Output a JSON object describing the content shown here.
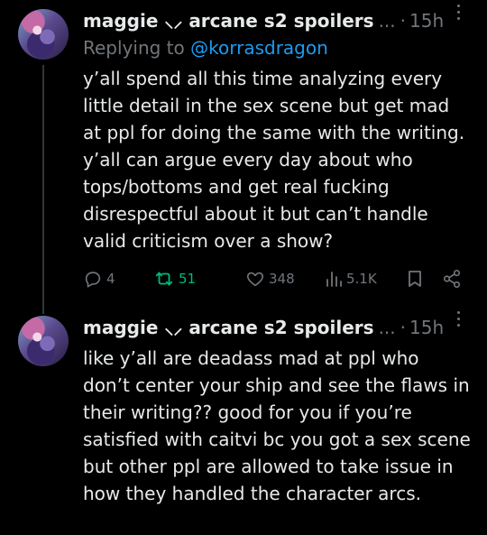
{
  "tweets": [
    {
      "display_name": "maggie ⸜⸝ arcane s2 spoilers",
      "ellipsis": "...",
      "dot": "·",
      "time": "15h",
      "reply_prefix": "Replying to",
      "reply_handle": "@korrasdragon",
      "text": "y’all spend all this time analyzing every little detail in the sex scene but get mad at ppl for doing the same with the writing. y’all can argue every day about who tops/bottoms and get real fucking disrespectful about it but can’t handle valid criticism over a show?",
      "stats": {
        "replies": "4",
        "retweets": "51",
        "likes": "348",
        "views": "5.1K"
      }
    },
    {
      "display_name": "maggie ⸜⸝ arcane s2 spoilers",
      "ellipsis": "...",
      "dot": "·",
      "time": "15h",
      "text": "like y’all are deadass mad at ppl who don’t center your ship and see the flaws in their writing?? good for you if you’re satisfied with caitvi bc you got a sex scene but other ppl are allowed to take issue in how they handled the character arcs."
    }
  ],
  "colors": {
    "background": "#000000",
    "text": "#e7e9ea",
    "muted": "#71767b",
    "link": "#1d9bf0",
    "retweet_active": "#00ba7c"
  },
  "icons": [
    "reply-icon",
    "retweet-icon",
    "like-icon",
    "views-icon",
    "bookmark-icon",
    "share-icon",
    "more-icon"
  ]
}
